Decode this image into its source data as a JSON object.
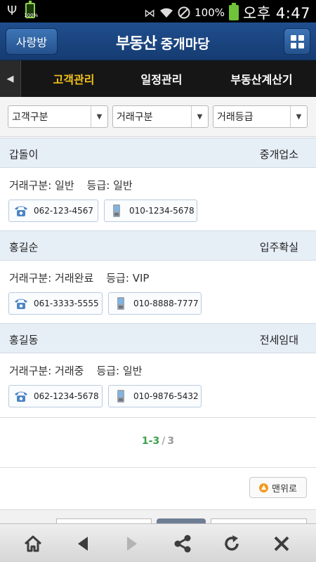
{
  "status_bar": {
    "battery_mini_label": "100%",
    "battery_percent": "100%",
    "time": "오후 4:47"
  },
  "header": {
    "left_button": "사랑방",
    "brand": "부동산",
    "subtitle": "중개마당"
  },
  "tabs": [
    {
      "label": "고객관리",
      "active": true
    },
    {
      "label": "일정관리",
      "active": false
    },
    {
      "label": "부동산계산기",
      "active": false
    }
  ],
  "filters": {
    "customer_type": "고객구분",
    "deal_type": "거래구분",
    "grade": "거래등급"
  },
  "customers": [
    {
      "name": "갑돌이",
      "category": "중개업소",
      "deal_label": "거래구분:",
      "deal_value": "일반",
      "grade_label": "등급:",
      "grade_value": "일반",
      "phone": "062-123-4567",
      "mobile": "010-1234-5678"
    },
    {
      "name": "홍길순",
      "category": "입주확실",
      "deal_label": "거래구분:",
      "deal_value": "거래완료",
      "grade_label": "등급:",
      "grade_value": "VIP",
      "phone": "061-3333-5555",
      "mobile": "010-8888-7777"
    },
    {
      "name": "홍길동",
      "category": "전세임대",
      "deal_label": "거래구분:",
      "deal_value": "거래중",
      "grade_label": "등급:",
      "grade_value": "일반",
      "phone": "062-1234-5678",
      "mobile": "010-9876-5432"
    }
  ],
  "pagination": {
    "current": "1-3",
    "separator": "/",
    "total": "3"
  },
  "back_to_top": "맨위로",
  "browser_nav": {
    "icons": [
      "home-icon",
      "back-icon",
      "forward-icon",
      "share-icon",
      "refresh-icon",
      "close-icon"
    ]
  },
  "colors": {
    "header_blue": "#1f4e8e",
    "active_tab": "#f2c21a",
    "card_head_bg": "#e6eef6",
    "pager_green": "#3aa14a"
  }
}
